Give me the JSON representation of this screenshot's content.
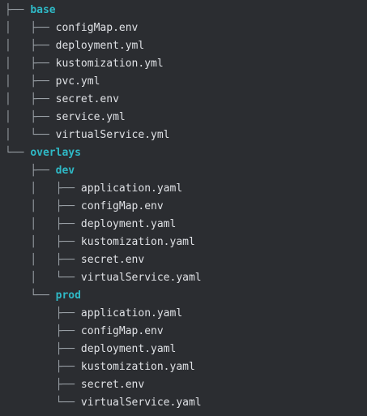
{
  "tree": {
    "rows": [
      {
        "prefix": "├── ",
        "name": "base",
        "type": "dir"
      },
      {
        "prefix": "│   ├── ",
        "name": "configMap.env",
        "type": "file"
      },
      {
        "prefix": "│   ├── ",
        "name": "deployment.yml",
        "type": "file"
      },
      {
        "prefix": "│   ├── ",
        "name": "kustomization.yml",
        "type": "file"
      },
      {
        "prefix": "│   ├── ",
        "name": "pvc.yml",
        "type": "file"
      },
      {
        "prefix": "│   ├── ",
        "name": "secret.env",
        "type": "file"
      },
      {
        "prefix": "│   ├── ",
        "name": "service.yml",
        "type": "file"
      },
      {
        "prefix": "│   └── ",
        "name": "virtualService.yml",
        "type": "file"
      },
      {
        "prefix": "└── ",
        "name": "overlays",
        "type": "dir"
      },
      {
        "prefix": "    ├── ",
        "name": "dev",
        "type": "dir"
      },
      {
        "prefix": "    │   ├── ",
        "name": "application.yaml",
        "type": "file"
      },
      {
        "prefix": "    │   ├── ",
        "name": "configMap.env",
        "type": "file"
      },
      {
        "prefix": "    │   ├── ",
        "name": "deployment.yaml",
        "type": "file"
      },
      {
        "prefix": "    │   ├── ",
        "name": "kustomization.yaml",
        "type": "file"
      },
      {
        "prefix": "    │   ├── ",
        "name": "secret.env",
        "type": "file"
      },
      {
        "prefix": "    │   └── ",
        "name": "virtualService.yaml",
        "type": "file"
      },
      {
        "prefix": "    └── ",
        "name": "prod",
        "type": "dir"
      },
      {
        "prefix": "        ├── ",
        "name": "application.yaml",
        "type": "file"
      },
      {
        "prefix": "        ├── ",
        "name": "configMap.env",
        "type": "file"
      },
      {
        "prefix": "        ├── ",
        "name": "deployment.yaml",
        "type": "file"
      },
      {
        "prefix": "        ├── ",
        "name": "kustomization.yaml",
        "type": "file"
      },
      {
        "prefix": "        ├── ",
        "name": "secret.env",
        "type": "file"
      },
      {
        "prefix": "        └── ",
        "name": "virtualService.yaml",
        "type": "file"
      }
    ]
  },
  "colors": {
    "background": "#2b2d31",
    "directory": "#2fb9c6",
    "file": "#dfe1e5",
    "connector": "#9aa0a6"
  }
}
